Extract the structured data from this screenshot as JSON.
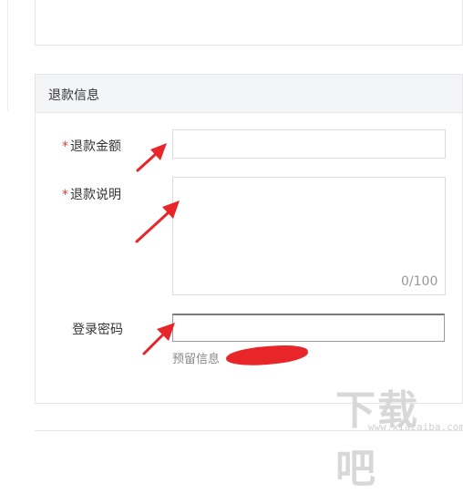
{
  "section": {
    "title": "退款信息"
  },
  "form": {
    "amount": {
      "required_mark": "*",
      "label": "退款金额",
      "value": ""
    },
    "reason": {
      "required_mark": "*",
      "label": "退款说明",
      "value": "",
      "counter": "0/100"
    },
    "password": {
      "label": "登录密码",
      "value": "",
      "hint": "预留信息"
    }
  },
  "watermark": {
    "chars": "下载吧",
    "url": "www.xiazaiba.com"
  },
  "colors": {
    "required": "#e4393c",
    "annotation_arrow": "#e8262a",
    "header_bg": "#f4f5f7"
  },
  "icons": [
    "annotation-arrow-icon",
    "redaction-scribble"
  ]
}
